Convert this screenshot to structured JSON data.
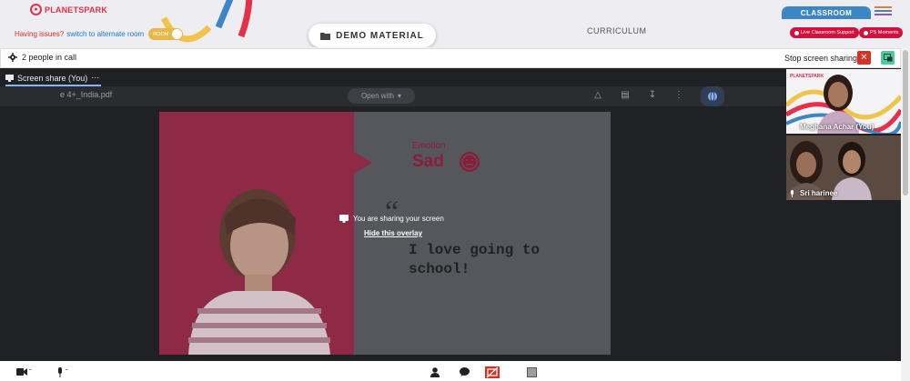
{
  "brand": {
    "logo_text": "PLANETSPARK"
  },
  "header": {
    "issues_text": "Having issues?",
    "switch_link": "switch to alternate room",
    "toggle_label": "ROOM",
    "demo_material": "DEMO MATERIAL",
    "curriculum": "CURRICULUM",
    "classroom_tab": "CLASSROOM",
    "live_support": "Live Classroom Support",
    "ps_moments": "PS Moments"
  },
  "meet": {
    "people_in_call": "2 people in call",
    "stop_sharing": "Stop screen sharing",
    "screen_share_tab": "Screen share (You)",
    "more": "⋯",
    "sharing_message": "You are sharing your screen",
    "hide_overlay": "Hide this overlay"
  },
  "pdf_viewer": {
    "file_name": "e 4+_India.pdf",
    "open_with": "Open with"
  },
  "slide": {
    "emotion_label": "Emotion",
    "emotion_word": "Sad",
    "quote_mark": "“",
    "sentence": "I love going to school!"
  },
  "participants": [
    {
      "name": "Meghana Achar (You)"
    },
    {
      "name": "Sri harinee"
    }
  ],
  "colors": {
    "brand_red": "#e5304a",
    "classroom_blue": "#3d86c6",
    "support_red": "#d1123f",
    "stop_red": "#d93025",
    "pip_green": "#4ecb9c",
    "stage_dark": "#202124"
  }
}
